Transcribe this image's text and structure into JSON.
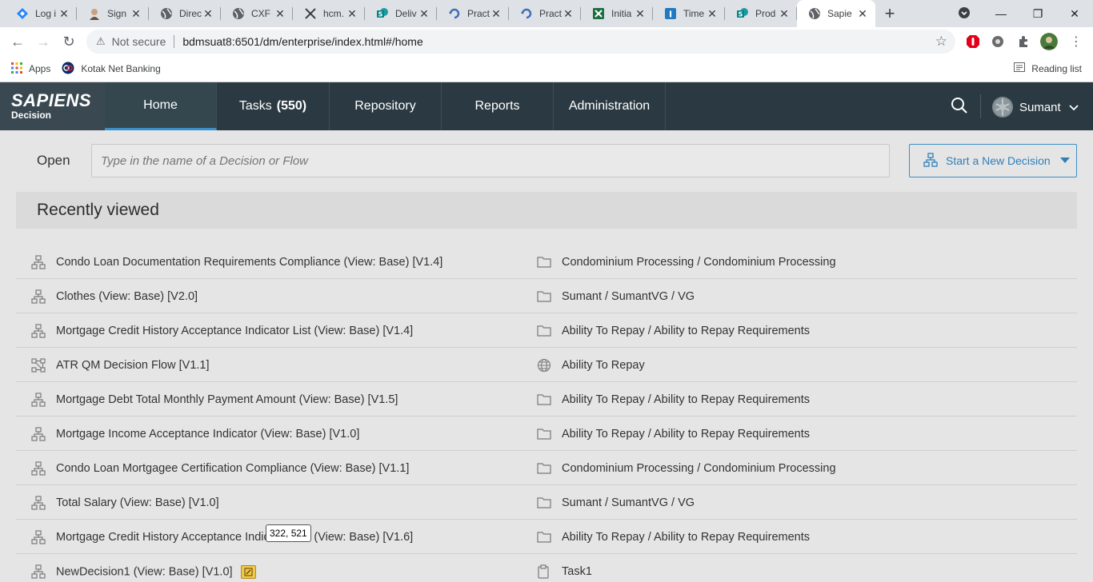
{
  "browser": {
    "tabs": [
      {
        "title": "Log i",
        "icon": "jira-icon"
      },
      {
        "title": "Sign",
        "icon": "user-avatar-icon"
      },
      {
        "title": "Direc",
        "icon": "globe-icon"
      },
      {
        "title": "CXF -",
        "icon": "globe-icon"
      },
      {
        "title": "hcm.",
        "icon": "x-brand-icon"
      },
      {
        "title": "Deliv",
        "icon": "sharepoint-icon"
      },
      {
        "title": "Pract",
        "icon": "refresh-brand-icon"
      },
      {
        "title": "Pract",
        "icon": "refresh-brand-icon"
      },
      {
        "title": "Initia",
        "icon": "excel-icon"
      },
      {
        "title": "Time",
        "icon": "itime-icon"
      },
      {
        "title": "Prod",
        "icon": "sharepoint-icon"
      },
      {
        "title": "Sapie",
        "icon": "globe-icon",
        "active": true
      }
    ],
    "address": {
      "security_label": "Not secure",
      "url": "bdmsuat8:6501/dm/enterprise/index.html#/home"
    },
    "bookmarks": {
      "apps_label": "Apps",
      "kotak_label": "Kotak Net Banking",
      "reading_list_label": "Reading list"
    }
  },
  "app": {
    "logo": {
      "line1": "SAPIENS",
      "line2": "Decision"
    },
    "nav": {
      "home": "Home",
      "tasks": "Tasks",
      "tasks_count": "(550)",
      "repository": "Repository",
      "reports": "Reports",
      "administration": "Administration"
    },
    "user_name": "Sumant",
    "open_label": "Open",
    "open_placeholder": "Type in the name of a Decision or Flow",
    "new_decision_label": "Start a New Decision",
    "recently_viewed_title": "Recently viewed",
    "recent": [
      {
        "name": "Condo Loan Documentation Requirements Compliance (View: Base) [V1.4]",
        "type_icon": "decision-icon",
        "location": "Condominium Processing / Condominium Processing",
        "location_icon": "folder-icon"
      },
      {
        "name": "Clothes (View: Base) [V2.0]",
        "type_icon": "decision-icon",
        "location": "Sumant / SumantVG / VG",
        "location_icon": "folder-icon"
      },
      {
        "name": "Mortgage Credit History Acceptance Indicator List (View: Base) [V1.4]",
        "type_icon": "decision-icon",
        "location": "Ability To Repay / Ability to Repay Requirements",
        "location_icon": "folder-icon"
      },
      {
        "name": "ATR QM Decision Flow [V1.1]",
        "type_icon": "flow-icon",
        "location": "Ability To Repay",
        "location_icon": "globe-icon"
      },
      {
        "name": "Mortgage Debt Total Monthly Payment Amount (View: Base) [V1.5]",
        "type_icon": "decision-icon",
        "location": "Ability To Repay / Ability to Repay Requirements",
        "location_icon": "folder-icon"
      },
      {
        "name": "Mortgage Income Acceptance Indicator (View: Base) [V1.0]",
        "type_icon": "decision-icon",
        "location": "Ability To Repay / Ability to Repay Requirements",
        "location_icon": "folder-icon"
      },
      {
        "name": "Condo Loan Mortgagee Certification Compliance (View: Base) [V1.1]",
        "type_icon": "decision-icon",
        "location": "Condominium Processing / Condominium Processing",
        "location_icon": "folder-icon"
      },
      {
        "name": "Total Salary (View: Base) [V1.0]",
        "type_icon": "decision-icon",
        "location": "Sumant / SumantVG / VG",
        "location_icon": "folder-icon"
      },
      {
        "name": "Mortgage Credit History Acceptance Indicator List (View: Base) [V1.6]",
        "type_icon": "decision-icon",
        "location": "Ability To Repay / Ability to Repay Requirements",
        "location_icon": "folder-icon"
      },
      {
        "name": "NewDecision1 (View: Base) [V1.0]",
        "type_icon": "decision-icon",
        "location": "Task1",
        "location_icon": "clipboard-icon",
        "editing": true
      }
    ],
    "tooltip": "322, 521"
  }
}
